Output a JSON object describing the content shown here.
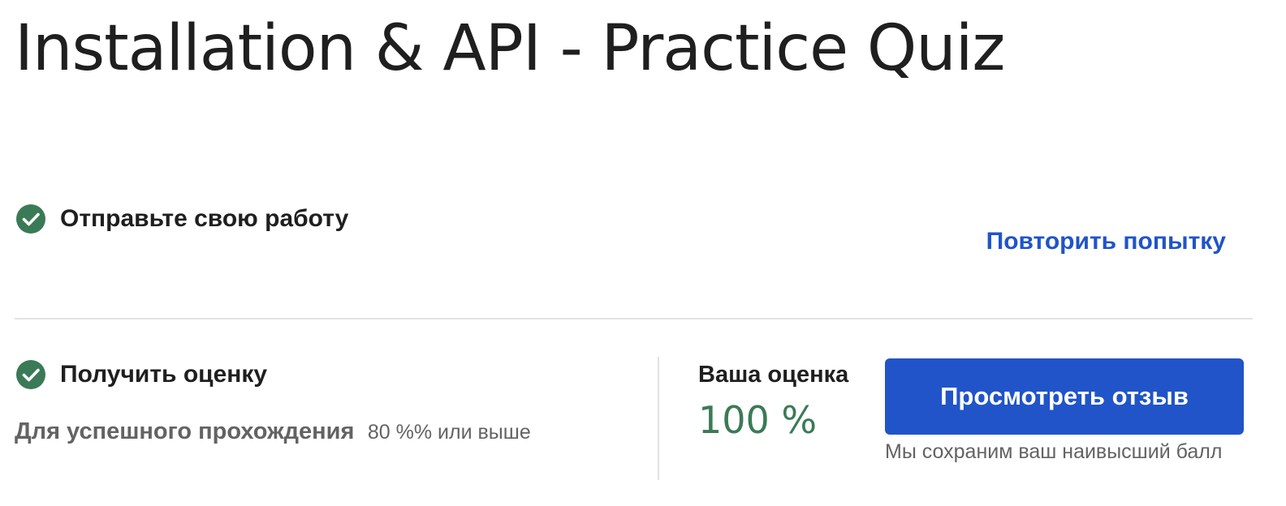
{
  "page": {
    "title": "Installation & API - Practice Quiz"
  },
  "submit_step": {
    "title": "Отправьте свою работу",
    "retry_label": "Повторить попытку"
  },
  "grade_step": {
    "title": "Получить оценку",
    "passing_label": "Для успешного прохождения",
    "passing_value": "80 %% или выше",
    "your_grade_label": "Ваша оценка",
    "your_grade_value": "100 %",
    "view_feedback_label": "Просмотреть отзыв",
    "save_note": "Мы сохраним ваш наивысший балл"
  },
  "icons": {
    "step_complete": "check-circle-icon"
  },
  "colors": {
    "accent_blue": "#2054c8",
    "success_green": "#3b7a56",
    "text_dark": "#1f1f1f",
    "text_muted": "#636363",
    "divider": "#e3e3e3"
  }
}
